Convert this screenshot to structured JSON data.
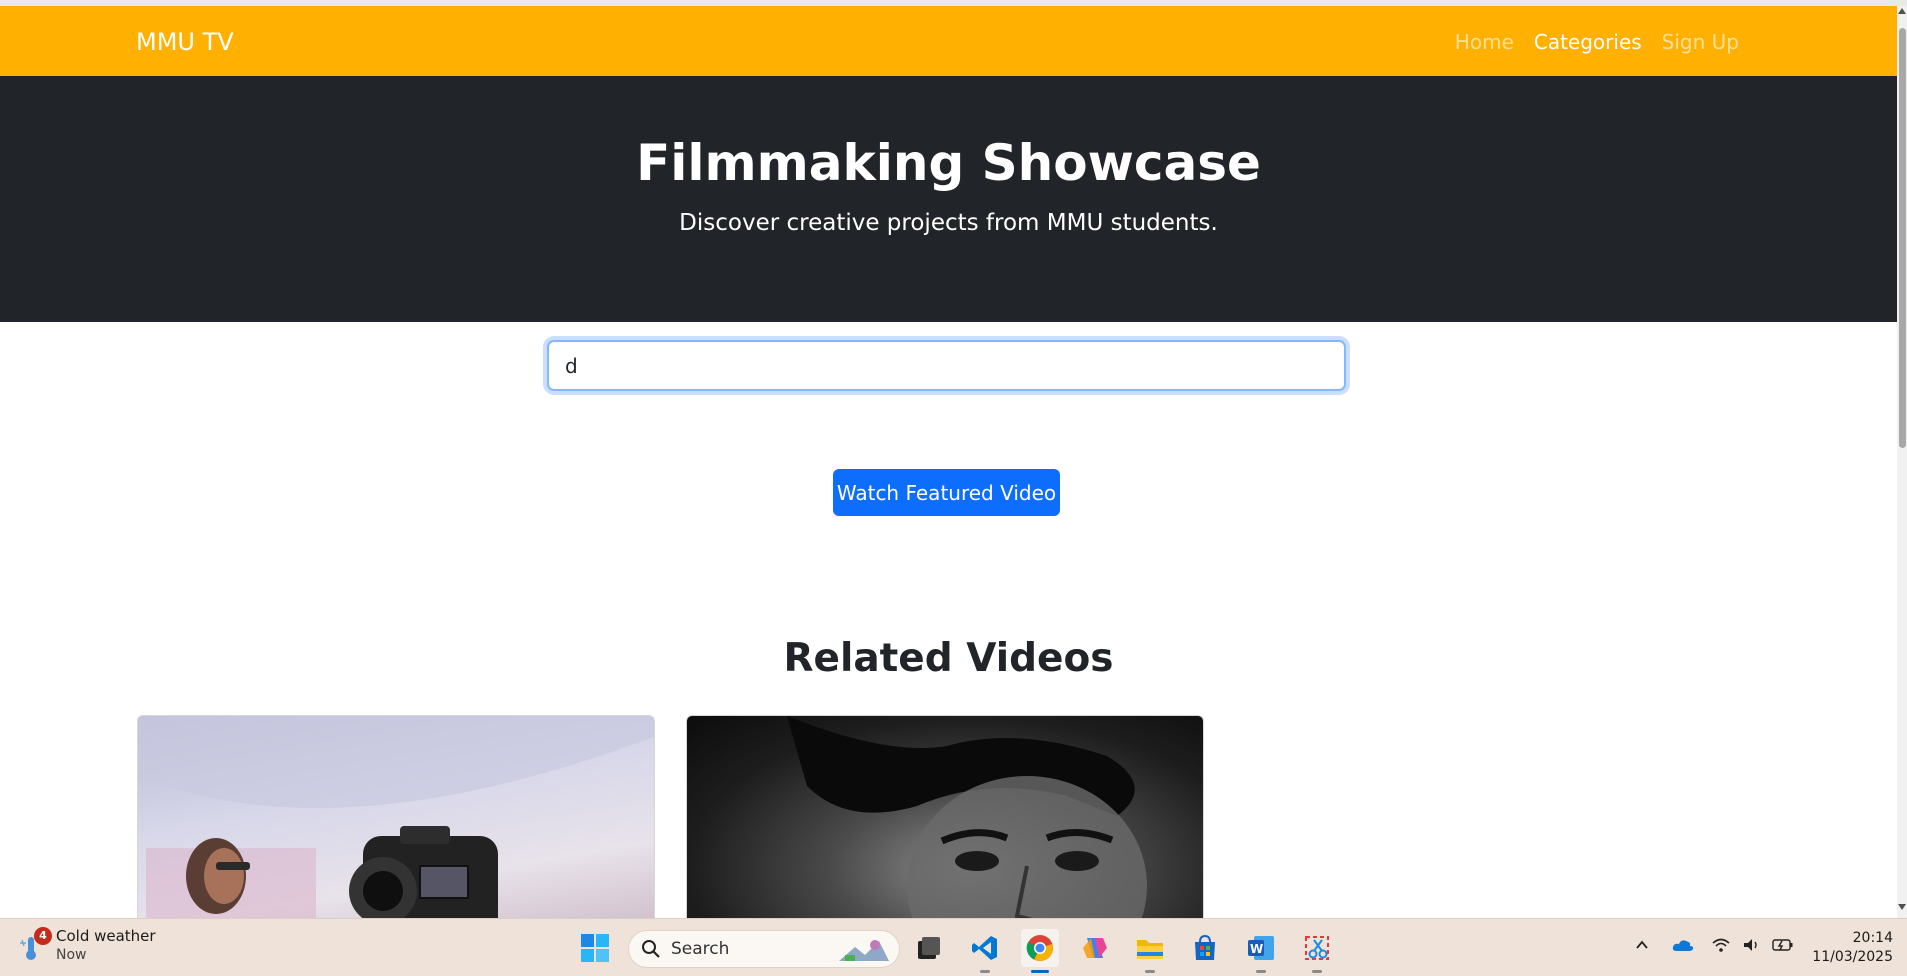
{
  "navbar": {
    "brand": "MMU TV",
    "links": [
      {
        "label": "Home",
        "active": false
      },
      {
        "label": "Categories",
        "active": true
      },
      {
        "label": "Sign Up",
        "active": false
      }
    ],
    "color": "#ffb000"
  },
  "hero": {
    "title": "Filmmaking Showcase",
    "subtitle": "Discover creative projects from MMU students.",
    "background": "#212529"
  },
  "search": {
    "value": "d"
  },
  "featured": {
    "button_label": "Watch Featured Video",
    "color": "#0d6efd"
  },
  "related": {
    "title": "Related Videos",
    "cards": [
      {
        "thumbnail": "person-with-camera-thumbnail"
      },
      {
        "thumbnail": "black-and-white-portrait-thumbnail"
      }
    ]
  },
  "taskbar": {
    "weather": {
      "title": "Cold weather",
      "time": "Now",
      "badge": "4"
    },
    "search_label": "Search",
    "apps": [
      "start-icon",
      "search-box",
      "task-view-icon",
      "vscode-icon",
      "chrome-icon",
      "copilot-icon",
      "file-explorer-icon",
      "store-icon",
      "word-icon",
      "snipping-tool-icon"
    ],
    "clock": {
      "time": "20:14",
      "date": "11/03/2025"
    }
  }
}
